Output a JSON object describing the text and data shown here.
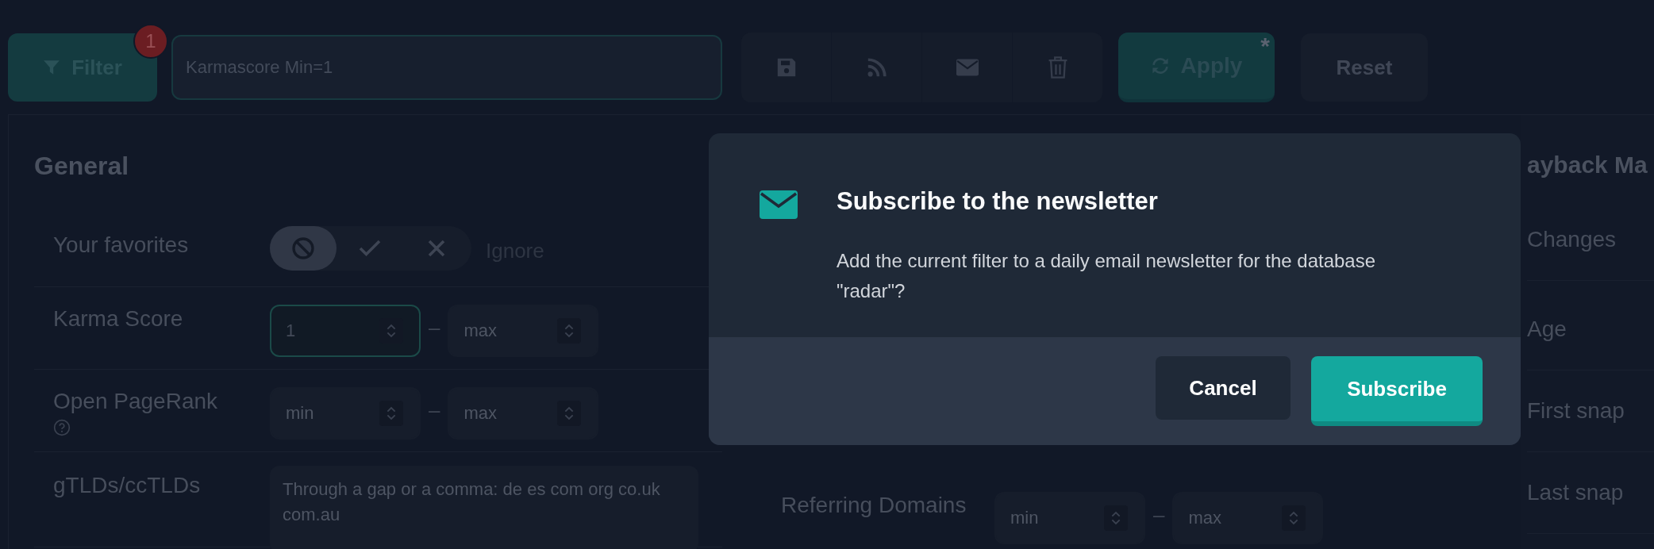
{
  "toolbar": {
    "filter_button": {
      "label": "Filter",
      "badge": "1"
    },
    "filter_input": {
      "value": "Karmascore Min=1"
    },
    "action_buttons": [
      {
        "kind": "save"
      },
      {
        "kind": "feed"
      },
      {
        "kind": "mail"
      },
      {
        "kind": "delete"
      }
    ],
    "apply_button": {
      "label": "Apply",
      "pending": "*"
    },
    "reset_button": {
      "label": "Reset"
    }
  },
  "general": {
    "title": "General",
    "rows": [
      {
        "kind": "tristate",
        "label": "Your favorites",
        "options": [
          {
            "kind": "ignore",
            "selected": true
          },
          {
            "kind": "include",
            "selected": false
          },
          {
            "kind": "exclude",
            "selected": false
          }
        ],
        "caption": "Ignore"
      },
      {
        "kind": "range",
        "label": "Karma Score",
        "min": {
          "value": "1",
          "focused": true
        },
        "separator": "–",
        "max": {
          "placeholder": "max",
          "focused": false
        }
      },
      {
        "kind": "range",
        "label": "Open PageRank",
        "help": true,
        "min": {
          "placeholder": "min",
          "focused": false
        },
        "separator": "–",
        "max": {
          "placeholder": "max",
          "focused": false
        }
      },
      {
        "kind": "text",
        "label": "gTLDs/ccTLDs",
        "placeholder": "Through a gap or a comma: de es com org co.uk com.au"
      }
    ]
  },
  "middle": {
    "rows": [
      {
        "kind": "range",
        "label": "Referring Domains",
        "min": {
          "placeholder": "min",
          "focused": false
        },
        "separator": "–",
        "max": {
          "placeholder": "max",
          "focused": false
        }
      }
    ]
  },
  "wayback": {
    "title": "ayback Ma",
    "rows": [
      {
        "label": "Changes"
      },
      {
        "label": "Age"
      },
      {
        "label": "First snap"
      },
      {
        "label": "Last snap"
      }
    ]
  },
  "modal": {
    "title": "Subscribe to the newsletter",
    "body": "Add the current filter to a daily email newsletter for the database \"radar\"?",
    "buttons": [
      {
        "kind": "secondary",
        "label": "Cancel"
      },
      {
        "kind": "primary",
        "label": "Subscribe"
      }
    ]
  }
}
